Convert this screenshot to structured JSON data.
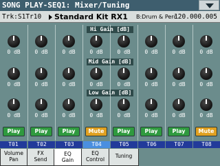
{
  "title": "SONG PLAY-SEQ1: Mixer/Tuning",
  "info": {
    "track": "Trk:S1Tr10",
    "kit": "Standard Kit RX1",
    "bank": "B:Drum & Perc.",
    "tempo": "120.000.005"
  },
  "sections": {
    "hi": "Hi Gain [dB]",
    "mid": "Mid Gain [dB]",
    "low": "Low Gain [dB]"
  },
  "tracks": [
    {
      "id": "T01",
      "hi": "0 dB",
      "mid": "0 dB",
      "low": "0 dB",
      "button": "Play",
      "state": "play"
    },
    {
      "id": "T02",
      "hi": "0 dB",
      "mid": "0 dB",
      "low": "0 dB",
      "button": "Play",
      "state": "play"
    },
    {
      "id": "T03",
      "hi": "0 dB",
      "mid": "0 dB",
      "low": "0 dB",
      "button": "Play",
      "state": "play"
    },
    {
      "id": "T04",
      "hi": "0 dB",
      "mid": "0 dB",
      "low": "0 dB",
      "button": "Mute",
      "state": "mute"
    },
    {
      "id": "T05",
      "hi": "0 dB",
      "mid": "0 dB",
      "low": "0 dB",
      "button": "Play",
      "state": "play"
    },
    {
      "id": "T06",
      "hi": "0 dB",
      "mid": "0 dB",
      "low": "0 dB",
      "button": "Play",
      "state": "play"
    },
    {
      "id": "T07",
      "hi": "0 dB",
      "mid": "0 dB",
      "low": "0 dB",
      "button": "Play",
      "state": "play"
    },
    {
      "id": "T08",
      "hi": "0 dB",
      "mid": "0 dB",
      "low": "0 dB",
      "button": "Mute",
      "state": "mute"
    }
  ],
  "selected_track": "T04",
  "tabs": [
    {
      "line1": "Volume",
      "line2": "Pan"
    },
    {
      "line1": "FX",
      "line2": "Send"
    },
    {
      "line1": "EQ",
      "line2": "Gain"
    },
    {
      "line1": "EQ",
      "line2": "Control"
    },
    {
      "line1": "Tuning",
      "line2": ""
    }
  ],
  "selected_tab": 2,
  "colors": {
    "panel": "#6b8c8c",
    "play": "#2f9a3f",
    "mute": "#e0a020",
    "track_label": "#223a9a",
    "track_label_selected": "#4a8fe0"
  },
  "icons": {
    "menu": "menu-triangle-down-icon",
    "track_arrow": "play-arrow-icon"
  }
}
